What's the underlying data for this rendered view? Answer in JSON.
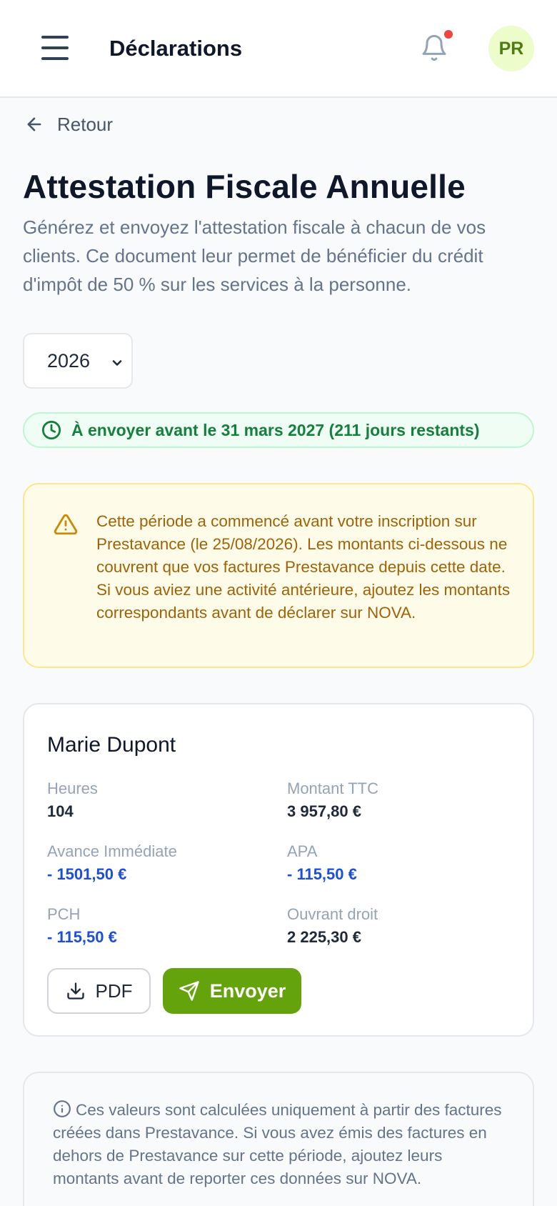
{
  "header": {
    "title": "Déclarations",
    "avatar_initials": "PR",
    "notification_dot_color": "#ef4444"
  },
  "back": {
    "label": "Retour"
  },
  "page": {
    "title": "Attestation Fiscale Annuelle",
    "subtitle": "Générez et envoyez l'attestation fiscale à chacun de vos clients. Ce document leur permet de bénéficier du crédit d'impôt de 50 % sur les services à la personne."
  },
  "year_select": {
    "selected": "2026"
  },
  "deadline": {
    "text": "À envoyer avant le 31 mars 2027 (211 jours restants)"
  },
  "warning": {
    "text": "Cette période a commencé avant votre inscription sur Prestavance (le 25/08/2026). Les montants ci-dessous ne couvrent que vos factures Prestavance depuis cette date. Si vous aviez une activité antérieure, ajoutez les montants correspondants avant de déclarer sur NOVA."
  },
  "client": {
    "name": "Marie Dupont",
    "hours_label": "Heures",
    "hours_value": "104",
    "ttc_label": "Montant TTC",
    "ttc_value": "3 957,80 €",
    "ai_label": "Avance Immédiate",
    "ai_value": "- 1501,50 €",
    "apa_label": "APA",
    "apa_value": "- 115,50 €",
    "pch_label": "PCH",
    "pch_value": "- 115,50 €",
    "od_label": "Ouvrant droit",
    "od_value": "2 225,30 €",
    "pdf_label": "PDF",
    "send_label": "Envoyer"
  },
  "info": {
    "text": "Ces valeurs sont calculées uniquement à partir des factures créées dans Prestavance. Si vous avez émis des factures en dehors de Prestavance sur cette période, ajoutez leurs montants avant de reporter ces données sur NOVA."
  },
  "colors": {
    "accent_green": "#65a30d",
    "deadline_green": "#15803d",
    "warning_text": "#a16207",
    "deduction_blue": "#1d4ed8"
  }
}
